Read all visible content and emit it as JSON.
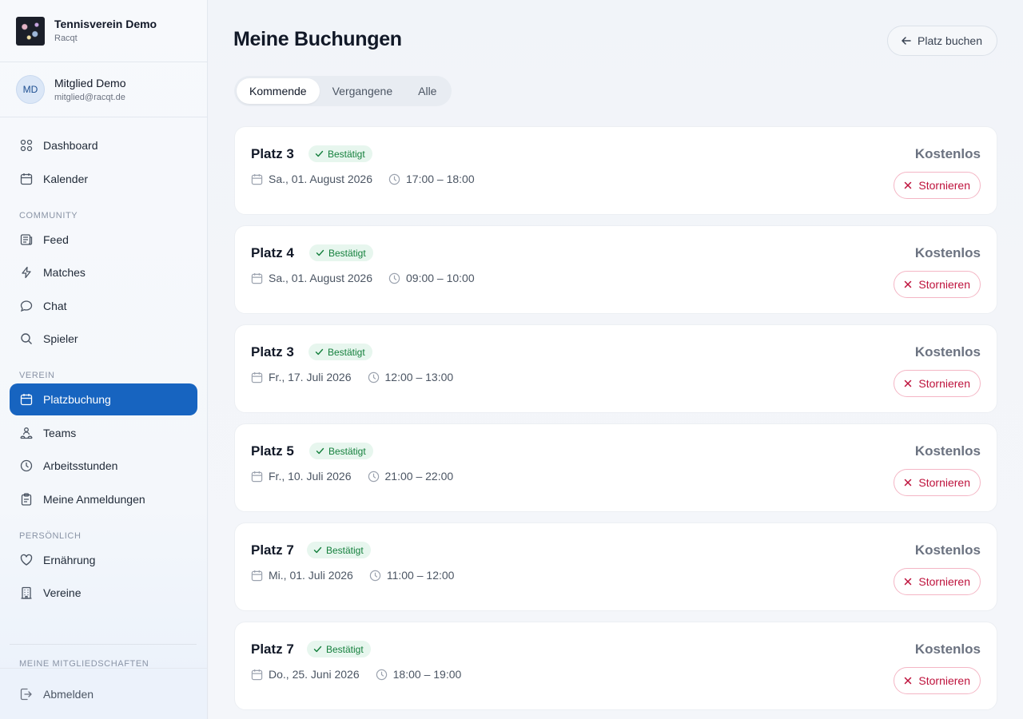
{
  "club": {
    "name": "Tennisverein Demo",
    "subtitle": "Racqt"
  },
  "user": {
    "initials": "MD",
    "name": "Mitglied Demo",
    "email": "mitglied@racqt.de"
  },
  "nav": {
    "dashboard": "Dashboard",
    "kalender": "Kalender",
    "section_community": "COMMUNITY",
    "feed": "Feed",
    "matches": "Matches",
    "chat": "Chat",
    "spieler": "Spieler",
    "section_verein": "VEREIN",
    "platzbuchung": "Platzbuchung",
    "teams": "Teams",
    "arbeitsstunden": "Arbeitsstunden",
    "anmeldungen": "Meine Anmeldungen",
    "section_persoenlich": "PERSÖNLICH",
    "ernaehrung": "Ernährung",
    "vereine": "Vereine",
    "section_mitgliedschaften": "MEINE MITGLIEDSCHAFTEN",
    "logout": "Abmelden"
  },
  "header": {
    "title": "Meine Buchungen",
    "book_button": "Platz buchen"
  },
  "tabs": {
    "upcoming": "Kommende",
    "past": "Vergangene",
    "all": "Alle",
    "active": "Kommende"
  },
  "bookings": [
    {
      "court": "Platz 3",
      "status": "Bestätigt",
      "date": "Sa., 01. August 2026",
      "time": "17:00 – 18:00",
      "price": "Kostenlos",
      "action": "Stornieren"
    },
    {
      "court": "Platz 4",
      "status": "Bestätigt",
      "date": "Sa., 01. August 2026",
      "time": "09:00 – 10:00",
      "price": "Kostenlos",
      "action": "Stornieren"
    },
    {
      "court": "Platz 3",
      "status": "Bestätigt",
      "date": "Fr., 17. Juli 2026",
      "time": "12:00 – 13:00",
      "price": "Kostenlos",
      "action": "Stornieren"
    },
    {
      "court": "Platz 5",
      "status": "Bestätigt",
      "date": "Fr., 10. Juli 2026",
      "time": "21:00 – 22:00",
      "price": "Kostenlos",
      "action": "Stornieren"
    },
    {
      "court": "Platz 7",
      "status": "Bestätigt",
      "date": "Mi., 01. Juli 2026",
      "time": "11:00 – 12:00",
      "price": "Kostenlos",
      "action": "Stornieren"
    },
    {
      "court": "Platz 7",
      "status": "Bestätigt",
      "date": "Do., 25. Juni 2026",
      "time": "18:00 – 19:00",
      "price": "Kostenlos",
      "action": "Stornieren"
    }
  ],
  "colors": {
    "accent": "#1764c0",
    "confirmed": "#15803d",
    "danger": "#be123c"
  }
}
